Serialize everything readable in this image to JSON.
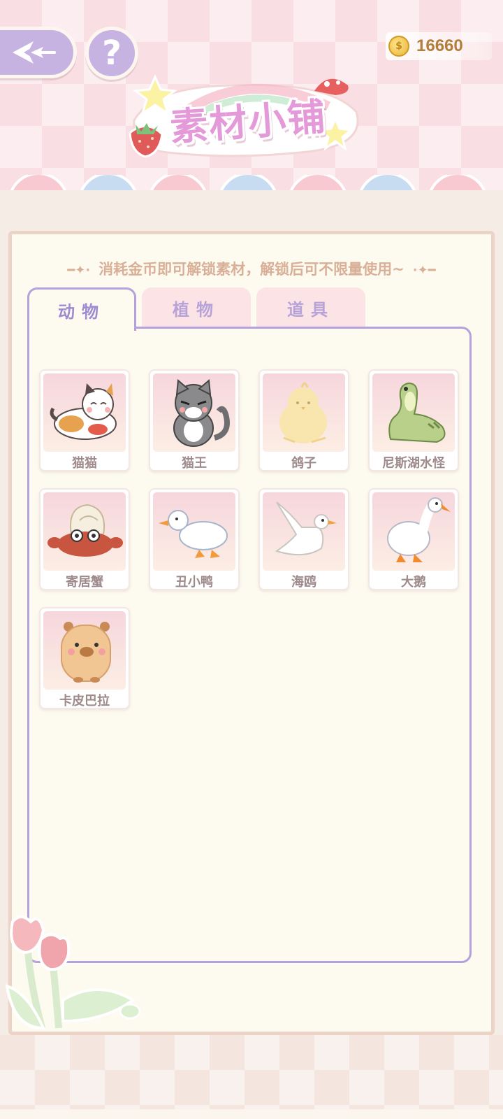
{
  "header": {
    "title": "素材小铺",
    "coins": "16660"
  },
  "panel": {
    "subtitle": "消耗金币即可解锁素材，解锁后可不限量使用~"
  },
  "tabs": [
    {
      "label": "动物",
      "active": true
    },
    {
      "label": "植物",
      "active": false
    },
    {
      "label": "道具",
      "active": false
    }
  ],
  "items": [
    {
      "label": "猫猫",
      "icon": "calico-cat"
    },
    {
      "label": "猫王",
      "icon": "tabby-cat"
    },
    {
      "label": "鸽子",
      "icon": "chick"
    },
    {
      "label": "尼斯湖水怪",
      "icon": "nessie"
    },
    {
      "label": "寄居蟹",
      "icon": "hermit-crab"
    },
    {
      "label": "丑小鸭",
      "icon": "duckling"
    },
    {
      "label": "海鸥",
      "icon": "seagull"
    },
    {
      "label": "大鹅",
      "icon": "goose"
    },
    {
      "label": "卡皮巴拉",
      "icon": "capybara"
    }
  ],
  "colors": {
    "accent": "#b3a2dc",
    "title": "#e49ad9",
    "coin": "#e8b43a"
  }
}
